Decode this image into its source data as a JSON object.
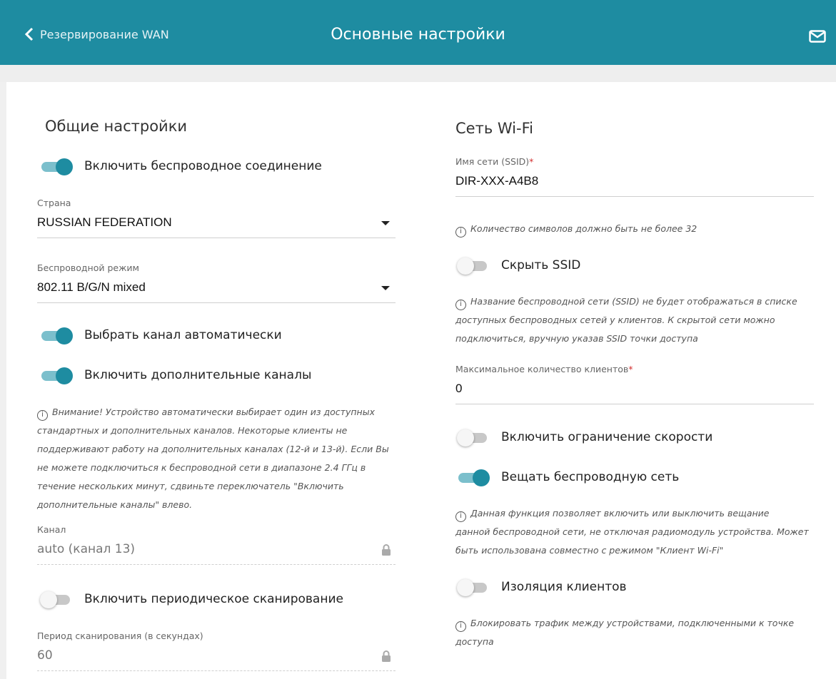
{
  "header": {
    "back_label": "Резервирование WAN",
    "title": "Основные настройки",
    "accent": "#1e8ca1"
  },
  "general": {
    "title": "Общие настройки",
    "enable_wireless": {
      "label": "Включить беспроводное соединение",
      "on": true
    },
    "country": {
      "label": "Страна",
      "value": "RUSSIAN FEDERATION"
    },
    "mode": {
      "label": "Беспроводной режим",
      "value": "802.11 B/G/N mixed"
    },
    "auto_channel": {
      "label": "Выбрать канал автоматически",
      "on": true
    },
    "extra_channels": {
      "label": "Включить дополнительные каналы",
      "on": true
    },
    "extra_channels_hint": {
      "line1": "Внимание! Устройство автоматически выбирает один из доступных",
      "line2": "стандартных и дополнительных каналов. Некоторые клиенты не",
      "line3": "поддерживают работу на дополнительных каналах (12-й и 13-й). Если Вы",
      "line4": "не можете подключиться к беспроводной сети в диапазоне 2.4 ГГц в",
      "line5": "течение нескольких минут, сдвиньте переключатель \"Включить",
      "line6": "дополнительные каналы\" влево."
    },
    "channel": {
      "label": "Канал",
      "value": "auto (канал 13)"
    },
    "periodic_scan": {
      "label": "Включить периодическое сканирование",
      "on": false
    },
    "scan_period": {
      "label": "Период сканирования (в секундах)",
      "value": "60"
    }
  },
  "wifi": {
    "title": "Сеть Wi-Fi",
    "ssid": {
      "label": "Имя сети (SSID)",
      "required_mark": "*",
      "value": "DIR-XXX-A4B8"
    },
    "ssid_hint": "Количество символов должно быть не более 32",
    "hide_ssid": {
      "label": "Скрыть SSID",
      "on": false
    },
    "hide_ssid_hint": {
      "line1": "Название беспроводной сети (SSID) не будет отображаться в списке",
      "line2": "доступных беспроводных сетей у клиентов. К скрытой сети можно",
      "line3": "подключиться, вручную указав SSID точки доступа"
    },
    "max_clients": {
      "label": "Максимальное количество клиентов",
      "required_mark": "*",
      "value": "0"
    },
    "speed_limit": {
      "label": "Включить ограничение скорости",
      "on": false
    },
    "broadcast": {
      "label": "Вещать беспроводную сеть",
      "on": true
    },
    "broadcast_hint": {
      "line1": "Данная функция позволяет включить или выключить вещание",
      "line2": "данной беспроводной сети, не отключая радиомодуль устройства. Может",
      "line3": "быть использована совместно с режимом \"Клиент Wi-Fi\""
    },
    "isolation": {
      "label": "Изоляция клиентов",
      "on": false
    },
    "isolation_hint": {
      "line1": "Блокировать трафик между устройствами, подключенными к точке",
      "line2": "доступа"
    }
  }
}
